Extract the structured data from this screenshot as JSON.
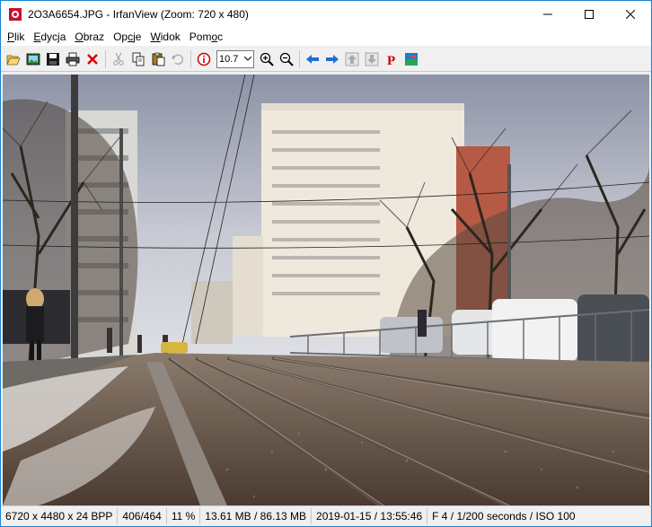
{
  "window": {
    "title": "2O3A6654.JPG - IrfanView (Zoom: 720 x 480)"
  },
  "menu": [
    {
      "pre": "",
      "ul": "P",
      "post": "lik"
    },
    {
      "pre": "",
      "ul": "E",
      "post": "dycja"
    },
    {
      "pre": "",
      "ul": "O",
      "post": "braz"
    },
    {
      "pre": "Op",
      "ul": "c",
      "post": "je"
    },
    {
      "pre": "",
      "ul": "W",
      "post": "idok"
    },
    {
      "pre": "Pom",
      "ul": "o",
      "post": "c"
    }
  ],
  "toolbar": {
    "zoom_value": "10.7"
  },
  "status": {
    "dimensions": "6720 x 4480 x 24 BPP",
    "index": "406/464",
    "zoom": "11 %",
    "size": "13.61 MB / 86.13 MB",
    "datetime": "2019-01-15 / 13:55:46",
    "exif": "F 4 / 1/200 seconds / ISO 100"
  },
  "icons": {
    "open": "open-folder-icon",
    "slideshow": "slideshow-icon",
    "save": "save-icon",
    "print": "print-icon",
    "delete": "delete-icon",
    "cut": "cut-icon",
    "copy": "copy-icon",
    "paste": "paste-icon",
    "undo": "undo-icon",
    "info": "info-icon",
    "zoom_in": "zoom-in-icon",
    "zoom_out": "zoom-out-icon",
    "prev": "previous-file-icon",
    "next": "next-file-icon",
    "first": "first-file-icon",
    "last": "last-file-icon",
    "paint": "paint-icon",
    "about": "irfanview-logo-icon"
  },
  "colors": {
    "accent": "#1883d7",
    "delete_red": "#d40000",
    "info_red": "#cc0000",
    "nav_blue": "#1e6fd1"
  }
}
